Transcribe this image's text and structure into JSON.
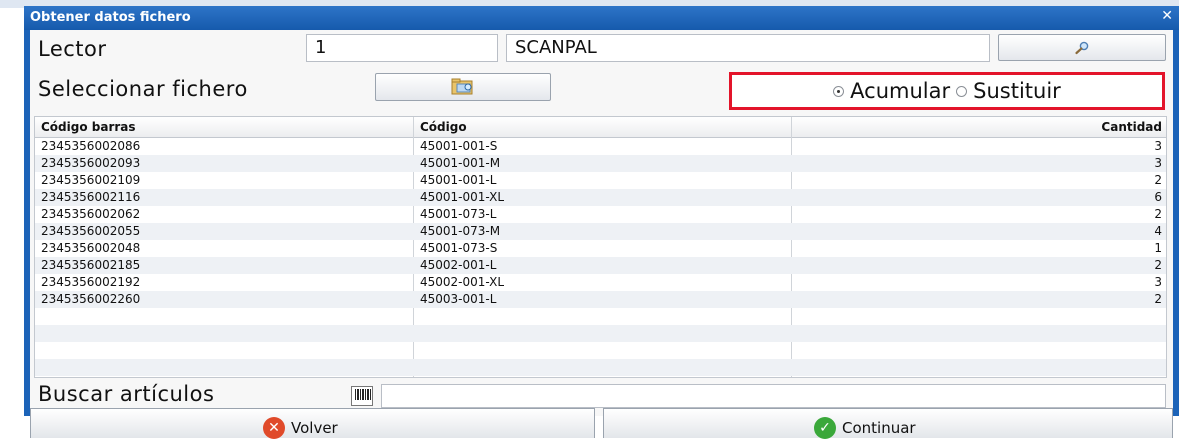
{
  "dialog": {
    "title": "Obtener datos fichero",
    "close_glyph": "✕"
  },
  "reader": {
    "label": "Lector",
    "id_value": "1",
    "name_value": "SCANPAL",
    "search_icon": "magnifier-icon"
  },
  "file": {
    "label": "Seleccionar fichero",
    "folder_icon": "folder-icon"
  },
  "mode": {
    "options": [
      "Acumular",
      "Sustituir"
    ],
    "selected": "Acumular",
    "highlight_color": "#e3142a"
  },
  "table": {
    "columns": [
      "Código barras",
      "Código",
      "Cantidad"
    ],
    "rows": [
      [
        "2345356002086",
        "45001-001-S",
        "3"
      ],
      [
        "2345356002093",
        "45001-001-M",
        "3"
      ],
      [
        "2345356002109",
        "45001-001-L",
        "2"
      ],
      [
        "2345356002116",
        "45001-001-XL",
        "6"
      ],
      [
        "2345356002062",
        "45001-073-L",
        "2"
      ],
      [
        "2345356002055",
        "45001-073-M",
        "4"
      ],
      [
        "2345356002048",
        "45001-073-S",
        "1"
      ],
      [
        "2345356002185",
        "45002-001-L",
        "2"
      ],
      [
        "2345356002192",
        "45002-001-XL",
        "3"
      ],
      [
        "2345356002260",
        "45003-001-L",
        "2"
      ]
    ]
  },
  "search": {
    "label": "Buscar artículos",
    "value": "",
    "barcode_icon": "barcode-icon"
  },
  "actions": {
    "back_label": "Volver",
    "continue_label": "Continuar",
    "back_color": "#e04a2a",
    "continue_color": "#3aa83a"
  }
}
